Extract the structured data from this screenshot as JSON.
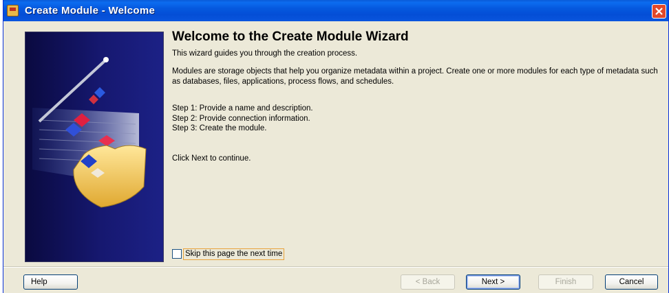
{
  "window": {
    "title": "Create Module - Welcome",
    "icon": "app-icon",
    "close_icon": "close-icon"
  },
  "main": {
    "heading": "Welcome to the Create Module Wizard",
    "intro": "This wizard guides you through the creation process.",
    "description": "Modules are storage objects that help you organize metadata within a project. Create one or more modules for each type of metadata such as databases, files, applications, process flows, and schedules.",
    "steps": [
      "Step 1: Provide a name and description.",
      "Step 2: Provide connection information.",
      "Step 3: Create the module."
    ],
    "continue_text": "Click Next to continue."
  },
  "skip_checkbox": {
    "label": "Skip this page the next time",
    "checked": false
  },
  "buttons": {
    "help": "Help",
    "back": "< Back",
    "next": "Next >",
    "finish": "Finish",
    "cancel": "Cancel"
  },
  "colors": {
    "title_bar": "#0558de",
    "dialog_bg": "#ece9d8",
    "side_panel": "#161870",
    "focus_outline": "#e8a23a"
  }
}
